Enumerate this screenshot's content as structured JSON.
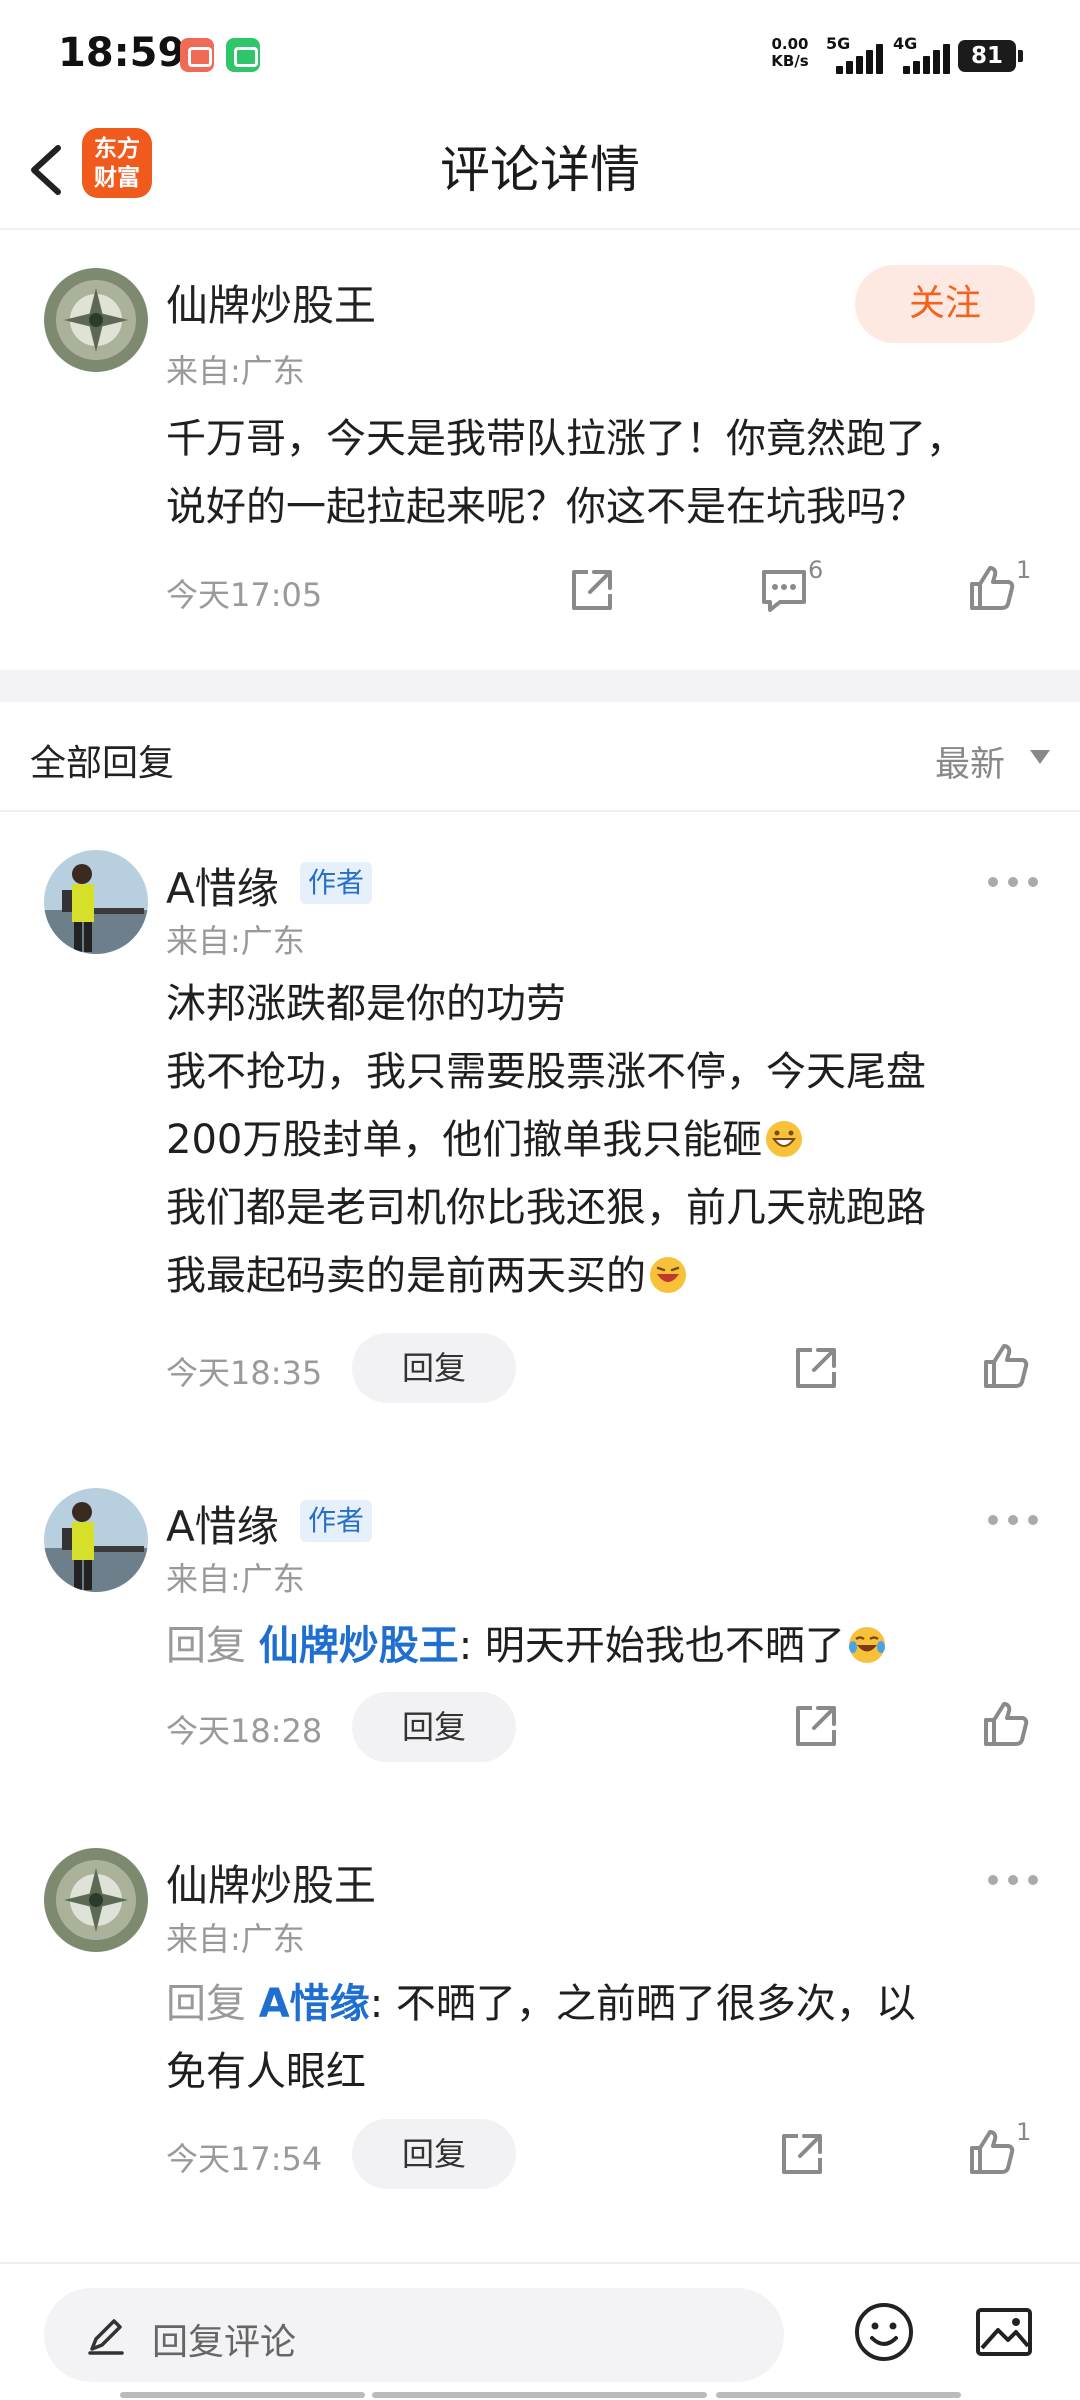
{
  "status_bar": {
    "time": "18:59",
    "net_speed_value": "0.00",
    "net_speed_unit": "KB/s",
    "sim1_label": "5G",
    "sim2_label": "4G",
    "battery": "81"
  },
  "header": {
    "logo_line1": "东方",
    "logo_line2": "财富",
    "title": "评论详情"
  },
  "main_comment": {
    "author": "仙牌炒股王",
    "location": "来自:广东",
    "follow_label": "关注",
    "content_lines": [
      "千万哥，今天是我带队拉涨了！你竟然跑了，",
      "说好的一起拉起来呢？你这不是在坑我吗？"
    ],
    "time": "今天17:05",
    "reply_count": "6",
    "like_count": "1"
  },
  "replies_header": {
    "title": "全部回复",
    "sort_label": "最新"
  },
  "replies": [
    {
      "author": "A惜缘",
      "badge": "作者",
      "location": "来自:广东",
      "content_lines": [
        "沐邦涨跌都是你的功劳",
        "我不抢功，我只需要股票涨不停，今天尾盘",
        "200万股封单，他们撤单我只能砸",
        "我们都是老司机你比我还狠，前几天就跑路",
        "我最起码卖的是前两天买的"
      ],
      "time": "今天18:35",
      "reply_label": "回复"
    },
    {
      "author": "A惜缘",
      "badge": "作者",
      "location": "来自:广东",
      "reply_prefix": "回复",
      "mention": "仙牌炒股王",
      "content_text": ": 明天开始我也不晒了",
      "time": "今天18:28",
      "reply_label": "回复"
    },
    {
      "author": "仙牌炒股王",
      "location": "来自:广东",
      "reply_prefix": "回复",
      "mention": "A惜缘",
      "content_text": ": 不晒了，之前晒了很多次，以",
      "content_line2": "免有人眼红",
      "time": "今天17:54",
      "reply_label": "回复",
      "like_count": "1"
    }
  ],
  "bottom_bar": {
    "placeholder": "回复评论"
  },
  "colors": {
    "brand_orange": "#f05a1c",
    "follow_bg": "#fde9e1",
    "mention_blue": "#1f6fd1",
    "badge_bg": "#e6f0fb"
  }
}
